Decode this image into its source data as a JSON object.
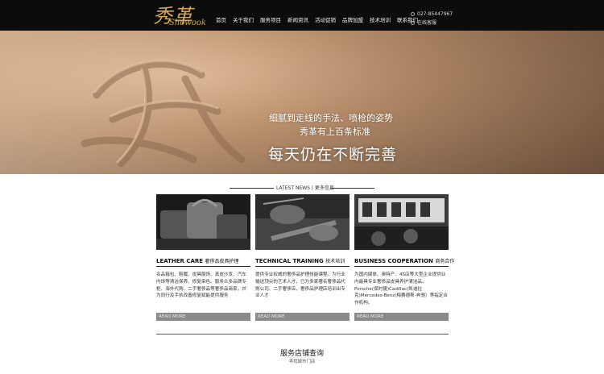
{
  "brand": {
    "name_cn": "秀革",
    "name_en": "Showook",
    "color": "#d4a94e"
  },
  "nav": [
    "首页",
    "关于我们",
    "服务项目",
    "新闻资讯",
    "活动促销",
    "品牌加盟",
    "技术培训",
    "联系我们"
  ],
  "contact": {
    "phone": "027-85447967",
    "service": "在线客服"
  },
  "banner": {
    "line1": "细腻到走线的手法、喷枪的姿势",
    "line2": "秀革有上百条标准",
    "line3": "每天仍在不断完善"
  },
  "news_header": "LATEST NEWS | 更多信息",
  "columns": [
    {
      "title": "LEATHER CARE",
      "subtitle": "奢侈品皮具护理",
      "desc": "名品箱包、鞋履、皮具服饰、真皮沙发、汽车内饰等清洁保养、修复染色。服务众多品牌专柜、海外代购、二手奢侈品等奢侈品商家，并为同行及手执改善修复赋能提供服务",
      "more": "READ MORE"
    },
    {
      "title": "TECHNICAL TRAINING",
      "subtitle": "技术培训",
      "desc": "提供专业权威的奢侈品护理技能课程。为行业输送顶尖的艺术人才，已为多家著名奢侈品代购公司、二手奢侈店、奢侈品护理店培训出专业人才",
      "more": "READ MORE"
    },
    {
      "title": "BUSINESS COOPERATION",
      "subtitle": "商务合作",
      "desc": "为国内媒体、奥特产、4S店等大型企业提供业内最具专业奢侈品皮具养护清洁品。Porsche(保时捷)Cadillac(凯迪拉克)Mercedes-Benz(梅赛德斯-奔驰）等指定合作机构。",
      "more": "READ MORE"
    }
  ],
  "store": {
    "title": "服务店铺查询",
    "subtitle": "寻找城市门店"
  }
}
